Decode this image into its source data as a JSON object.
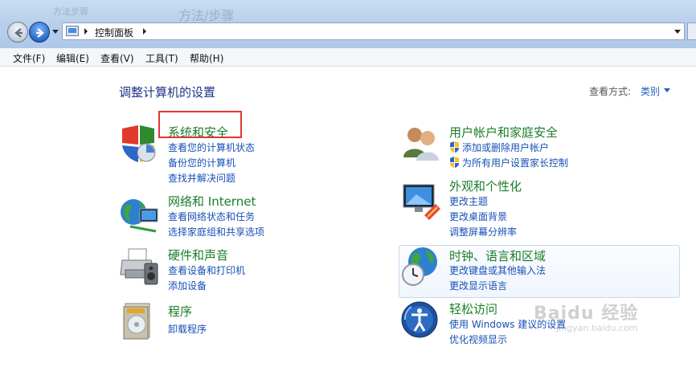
{
  "window": {
    "ghost_title_left": "方法/步骤",
    "ghost_title_small": "方法步骤"
  },
  "address": {
    "path": [
      "控制面板"
    ]
  },
  "menu": [
    "文件(F)",
    "编辑(E)",
    "查看(V)",
    "工具(T)",
    "帮助(H)"
  ],
  "page": {
    "title": "调整计算机的设置",
    "view_by_label": "查看方式:",
    "view_by_value": "类别"
  },
  "categories": [
    {
      "title": "系统和安全",
      "links": [
        "查看您的计算机状态",
        "备份您的计算机",
        "查找并解决问题"
      ],
      "icon": "shield-icon"
    },
    {
      "title": "网络和 Internet",
      "links": [
        "查看网络状态和任务",
        "选择家庭组和共享选项"
      ],
      "icon": "network-globe-icon"
    },
    {
      "title": "硬件和声音",
      "links": [
        "查看设备和打印机",
        "添加设备"
      ],
      "icon": "printer-icon"
    },
    {
      "title": "程序",
      "links": [
        "卸载程序"
      ],
      "icon": "programs-icon"
    },
    {
      "title": "用户帐户和家庭安全",
      "links": [
        "添加或删除用户帐户",
        "为所有用户设置家长控制"
      ],
      "icon": "users-icon"
    },
    {
      "title": "外观和个性化",
      "links": [
        "更改主题",
        "更改桌面背景",
        "调整屏幕分辨率"
      ],
      "icon": "appearance-monitor-icon"
    },
    {
      "title": "时钟、语言和区域",
      "links": [
        "更改键盘或其他输入法",
        "更改显示语言"
      ],
      "icon": "clock-globe-icon"
    },
    {
      "title": "轻松访问",
      "links": [
        "使用 Windows 建议的设置",
        "优化视频显示"
      ],
      "icon": "ease-of-access-icon"
    }
  ],
  "watermark": {
    "main": "Baidu 经验",
    "sub": "jingyan.baidu.com"
  },
  "colors": {
    "category_title": "#1b7d2b",
    "link": "#1750b5",
    "highlight": "#e23535"
  }
}
